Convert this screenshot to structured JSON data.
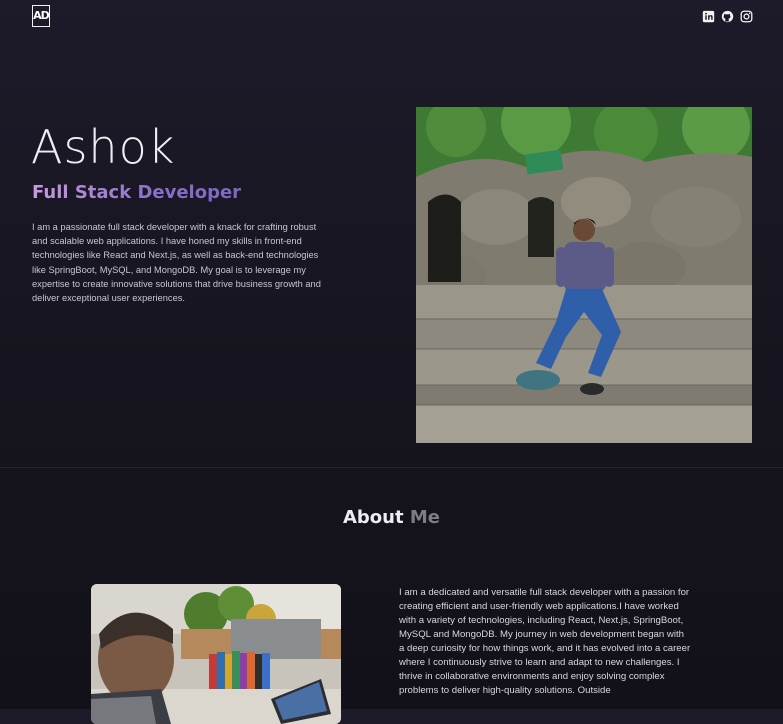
{
  "nav": {
    "logo_text": "AD",
    "socials": [
      {
        "icon": "linkedin-icon"
      },
      {
        "icon": "github-icon"
      },
      {
        "icon": "instagram-icon"
      }
    ]
  },
  "hero": {
    "name": "Ashok",
    "role": "Full Stack Developer",
    "description": "I am a passionate full stack developer with a knack for crafting robust and scalable web applications. I have honed my skills in front-end technologies like React and Next.js, as well as back-end technologies like SpringBoot, MySQL, and MongoDB. My goal is to leverage my expertise to create innovative solutions that drive business growth and deliver exceptional user experiences."
  },
  "about": {
    "title_word1": "About",
    "title_word2": "Me",
    "text": "I am a dedicated and versatile full stack developer with a passion for creating efficient and user-friendly web applications.I have worked with a variety of technologies, including React, Next.js, SpringBoot, MySQL and MongoDB. My journey in web development began with a deep curiosity for how things work, and it has evolved into a career where I continuously strive to learn and adapt to new challenges. I thrive in collaborative environments and enjoy solving complex problems to deliver high-quality solutions. Outside"
  },
  "colors": {
    "background": "#1a1824",
    "role_gradient_start": "#c79ae0",
    "role_gradient_end": "#7b68c2",
    "muted": "#7d7b86"
  }
}
